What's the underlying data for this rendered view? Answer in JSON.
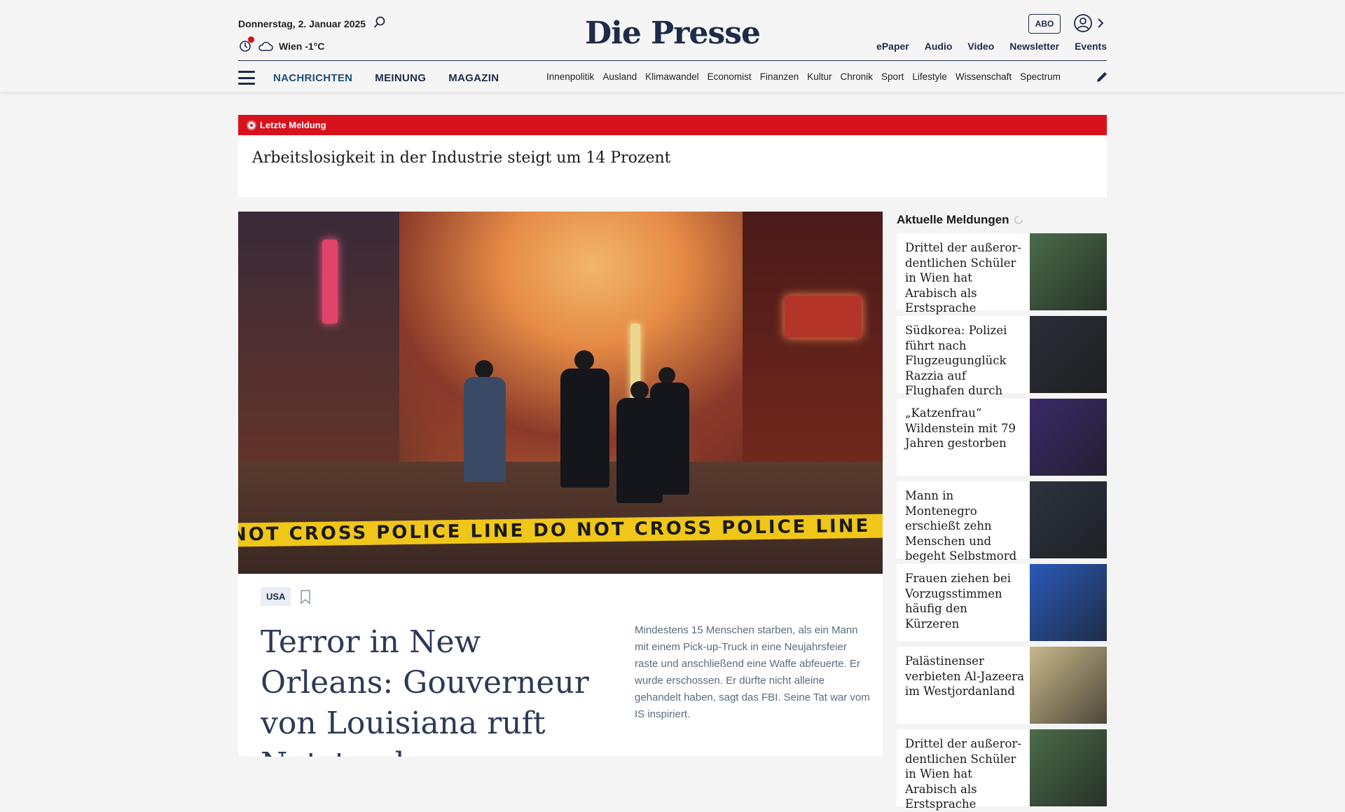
{
  "header": {
    "date": "Donnerstag, 2. Januar 2025",
    "weather": "Wien -1°C",
    "logo": "Die Presse",
    "abo_label": "ABO",
    "top_links": [
      "ePaper",
      "Audio",
      "Video",
      "Newsletter",
      "Events"
    ]
  },
  "nav": {
    "main": [
      "NACHRICHTEN",
      "MEINUNG",
      "MAGAZIN"
    ],
    "sub": [
      "Innenpolitik",
      "Ausland",
      "Klimawandel",
      "Economist",
      "Finanzen",
      "Kultur",
      "Chronik",
      "Sport",
      "Lifestyle",
      "Wissenschaft",
      "Spectrum"
    ]
  },
  "breaking": {
    "label": "Letzte Meldung",
    "title": "Arbeitslosigkeit in der Industrie steigt um 14 Prozent"
  },
  "main_article": {
    "tag": "USA",
    "headline": "Terror in New Orleans: Gouverneur von Louisiana ruft Notstand aus",
    "lead": "Mindestens 15 Menschen starben, als ein Mann mit einem Pick-up-Truck in eine Neujahrsfeier raste und anschließend eine Waffe abfeuerte. Er wurde erschossen. Er dürfte nicht alleine gehandelt haben, sagt das FBI. Seine Tat war vom IS inspiriert.",
    "image_tape_text": "NOT CROSS      POLICE LINE DO NOT CROSS      POLICE LINE"
  },
  "sidebar": {
    "title": "Aktuelle Meldungen",
    "items": [
      {
        "title": "Drittel der außeror­dentlichen Schüler in Wien hat Arabisch als Erstsprache",
        "thumb": "#4a6b4a"
      },
      {
        "title": "Südkorea: Polizei führt nach Flugzeug­unglück Razzia auf Flughafen durch",
        "thumb": "#2a2e36"
      },
      {
        "title": "„Katzenfrau“ Wildenstein mit 79 Jahren gestorben",
        "thumb": "#3a2a6a"
      },
      {
        "title": "Mann in Montenegro erschießt zehn Menschen und begeht Selbstmord",
        "thumb": "#2c3440"
      },
      {
        "title": "Frauen ziehen bei Vorzugsstimmen häufig den Kürzeren",
        "thumb": "#2a5ab8"
      },
      {
        "title": "Palästinenser verbieten Al-Jazeera im Westjordanland",
        "thumb": "#c8b88a"
      },
      {
        "title": "Drittel der außeror­dentlichen Schüler in Wien hat Arabisch als Erstsprache",
        "thumb": "#4a6b4a"
      }
    ]
  }
}
